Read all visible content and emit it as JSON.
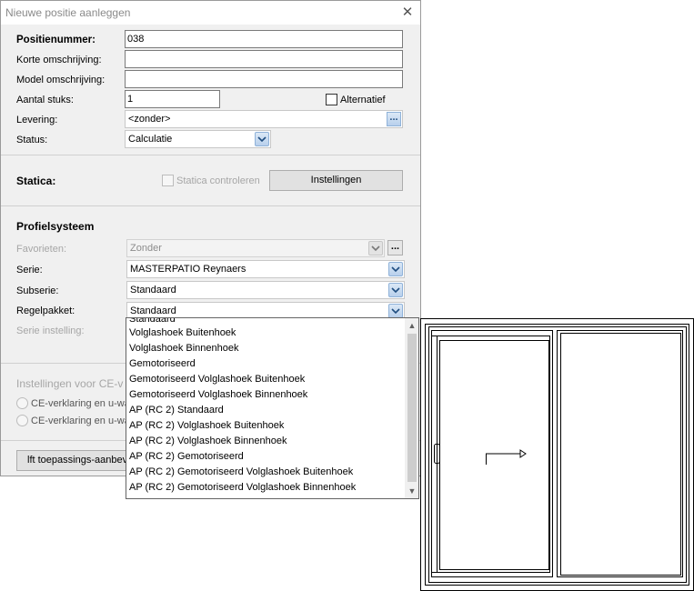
{
  "dialog": {
    "title": "Nieuwe positie aanleggen",
    "close_glyph": "✕"
  },
  "general": {
    "positienummer_label": "Positienummer:",
    "positienummer_value": "038",
    "korte_label": "Korte omschrijving:",
    "korte_value": "",
    "model_label": "Model omschrijving:",
    "model_value": "",
    "aantal_label": "Aantal stuks:",
    "aantal_value": "1",
    "alternatief_label": "Alternatief",
    "levering_label": "Levering:",
    "levering_value": "<zonder>",
    "levering_button": "...",
    "status_label": "Status:",
    "status_value": "Calculatie"
  },
  "statica": {
    "title": "Statica:",
    "check_label": "Statica controleren",
    "settings_button": "Instellingen"
  },
  "profielsysteem": {
    "title": "Profielsysteem",
    "favorieten_label": "Favorieten:",
    "favorieten_value": "Zonder",
    "favorieten_button": "...",
    "serie_label": "Serie:",
    "serie_value": "MASTERPATIO Reynaers",
    "subserie_label": "Subserie:",
    "subserie_value": "Standaard",
    "regelpakket_label": "Regelpakket:",
    "regelpakket_value": "Standaard",
    "serie_instelling_label": "Serie instelling:"
  },
  "ce": {
    "title": "Instellingen voor CE-v",
    "radio1": "CE-verklaring en u-wa",
    "radio2": "CE-verklaring en u-wa"
  },
  "bottom": {
    "button": "lft toepassings-aanbevel"
  },
  "dropdown": {
    "partial_item": "Standaard",
    "items": [
      "Volglashoek Buitenhoek",
      "Volglashoek Binnenhoek",
      "Gemotoriseerd",
      "Gemotoriseerd Volglashoek Buitenhoek",
      "Gemotoriseerd Volglashoek Binnenhoek",
      "AP (RC 2) Standaard",
      "AP (RC 2) Volglashoek Buitenhoek",
      "AP (RC 2) Volglashoek Binnenhoek",
      "AP (RC 2) Gemotoriseerd",
      "AP (RC 2) Gemotoriseerd Volglashoek Buitenhoek",
      "AP (RC 2) Gemotoriseerd Volglashoek Binnenhoek"
    ],
    "scroll_up": "▲",
    "scroll_down": "▼"
  },
  "colors": {
    "dialog_bg": "#f0f0f0",
    "combo_arrow": "#b8d0ec",
    "drawing_stroke": "#000000"
  }
}
